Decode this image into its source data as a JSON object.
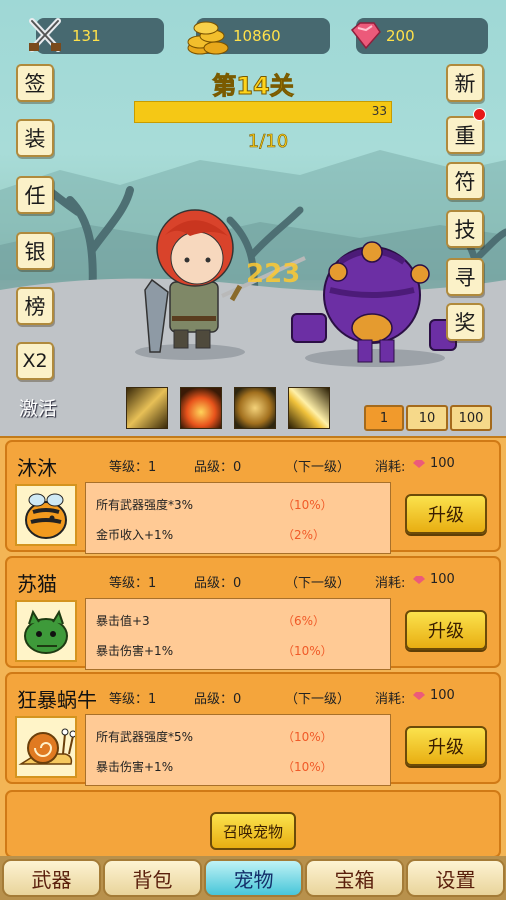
{
  "hud": {
    "swords": "131",
    "gold": "10860",
    "gems": "200"
  },
  "left_menu": [
    "签",
    "装",
    "任",
    "银",
    "榜",
    "X2"
  ],
  "right_menu": [
    "新",
    "重",
    "符",
    "技",
    "寻",
    "奖"
  ],
  "stage": {
    "title": "第14关",
    "hp_value": "33",
    "hp_fraction": 1.0,
    "wave": "1/10"
  },
  "damage_number": "223",
  "activate_label": "激活",
  "multipliers": [
    "1",
    "10",
    "100"
  ],
  "pets": [
    {
      "name": "沐沐",
      "level_label": "等级：1",
      "grade_label": "品级：0",
      "next_label": "（下一级）",
      "cost_label": "消耗:",
      "cost_value": "100",
      "stats": [
        {
          "name": "所有武器强度*3%",
          "next": "（10%）"
        },
        {
          "name": "金币收入+1%",
          "next": "（2%）"
        }
      ],
      "button": "升级"
    },
    {
      "name": "苏猫",
      "level_label": "等级：1",
      "grade_label": "品级：0",
      "next_label": "（下一级）",
      "cost_label": "消耗:",
      "cost_value": "100",
      "stats": [
        {
          "name": "暴击值+3",
          "next": "（6%）"
        },
        {
          "name": "暴击伤害+1%",
          "next": "（10%）"
        }
      ],
      "button": "升级"
    },
    {
      "name": "狂暴蜗牛",
      "level_label": "等级：1",
      "grade_label": "品级：0",
      "next_label": "（下一级）",
      "cost_label": "消耗:",
      "cost_value": "100",
      "stats": [
        {
          "name": "所有武器强度*5%",
          "next": "（10%）"
        },
        {
          "name": "暴击伤害+1%",
          "next": "（10%）"
        }
      ],
      "button": "升级"
    }
  ],
  "summon_button": "召唤宠物",
  "tabs": [
    "武器",
    "背包",
    "宠物",
    "宝箱",
    "设置"
  ],
  "colors": {
    "accent_yellow": "#ffd41c",
    "panel_orange": "#f4a53c",
    "active_tab": "#48c6d9",
    "gem_pink": "#ec5a7a"
  }
}
